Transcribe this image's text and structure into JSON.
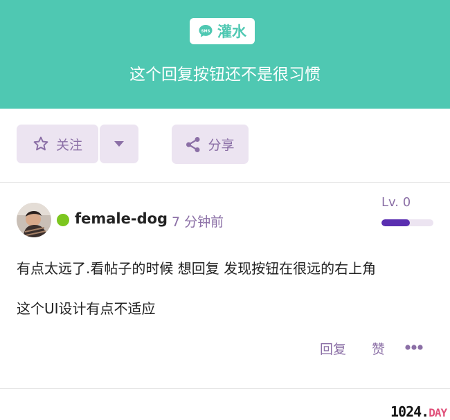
{
  "header": {
    "tag_label": "灌水",
    "tag_icon": "sms-bubble-icon",
    "title": "这个回复按钮还不是很习惯",
    "color": "#4fc8b2"
  },
  "actions": {
    "follow_label": "关注",
    "share_label": "分享"
  },
  "post": {
    "username": "female-dog",
    "time": "7 分钟前",
    "level": "Lv. 0",
    "level_progress": 0.55,
    "online": true,
    "paragraphs": [
      "有点太远了.看帖子的时候 想回复 发现按钮在很远的右上角",
      "这个UI设计有点不适应"
    ],
    "reply_label": "回复",
    "like_label": "赞"
  },
  "watermark": {
    "main": "1024.",
    "suffix": "DAY"
  },
  "colors": {
    "accent": "#8b6fa6",
    "button_bg": "#ece4f1",
    "online": "#7cc61f",
    "level_fill": "#5a2eb0"
  }
}
